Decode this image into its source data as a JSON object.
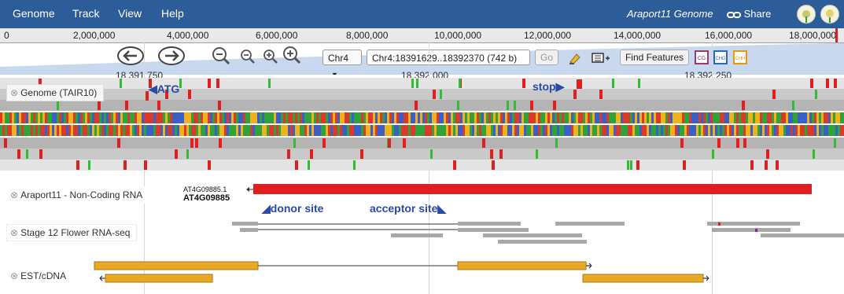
{
  "menubar": {
    "items": [
      "Genome",
      "Track",
      "View",
      "Help"
    ],
    "genome_name": "Araport11 Genome",
    "share_label": "Share",
    "share_icon": "link-icon",
    "bg_color": "#2c5d99"
  },
  "ruler": {
    "labels": [
      "0",
      "2,000,000",
      "4,000,000",
      "6,000,000",
      "8,000,000",
      "10,000,000",
      "12,000,000",
      "14,000,000",
      "16,000,000",
      "18,000,000"
    ]
  },
  "navigation": {
    "pan_left_icon": "arrow-left-icon",
    "pan_right_icon": "arrow-right-icon",
    "zoom_out_more_icon": "zoom-out-icon",
    "zoom_out_icon": "zoom-out-icon",
    "zoom_in_icon": "zoom-in-icon",
    "zoom_in_more_icon": "zoom-in-icon",
    "chromosome": "Chr4",
    "location": "Chr4:18391629..18392370 (742 b)",
    "go_label": "Go",
    "find_features_label": "Find Features",
    "highlight_icon": "highlighter-icon",
    "track_toggle_icon": "track-toggle-icon",
    "bookmark_icons": [
      "cg-icon",
      "chg-icon",
      "chh-icon"
    ]
  },
  "sub_ruler": {
    "labels": [
      "18,391,750",
      "18,392,000",
      "18,392,250"
    ]
  },
  "tracks": {
    "genome": {
      "label": "Genome (TAIR10)",
      "atg_label": "ATG",
      "stop_label": "stop"
    },
    "noncoding": {
      "label": "Araport11 - Non-Coding RNA",
      "transcript_id": "AT4G09885.1",
      "gene_id": "AT4G09885"
    },
    "rnaseq": {
      "label": "Stage 12 Flower RNA-seq",
      "donor_label": "donor site",
      "acceptor_label": "acceptor site"
    },
    "est": {
      "label": "EST/cDNA"
    }
  },
  "colors": {
    "accent_blue": "#2a4aa8",
    "red": "#e02020",
    "green": "#33bb33",
    "orange": "#e9a826",
    "read_gray": "#a8a8a8"
  }
}
